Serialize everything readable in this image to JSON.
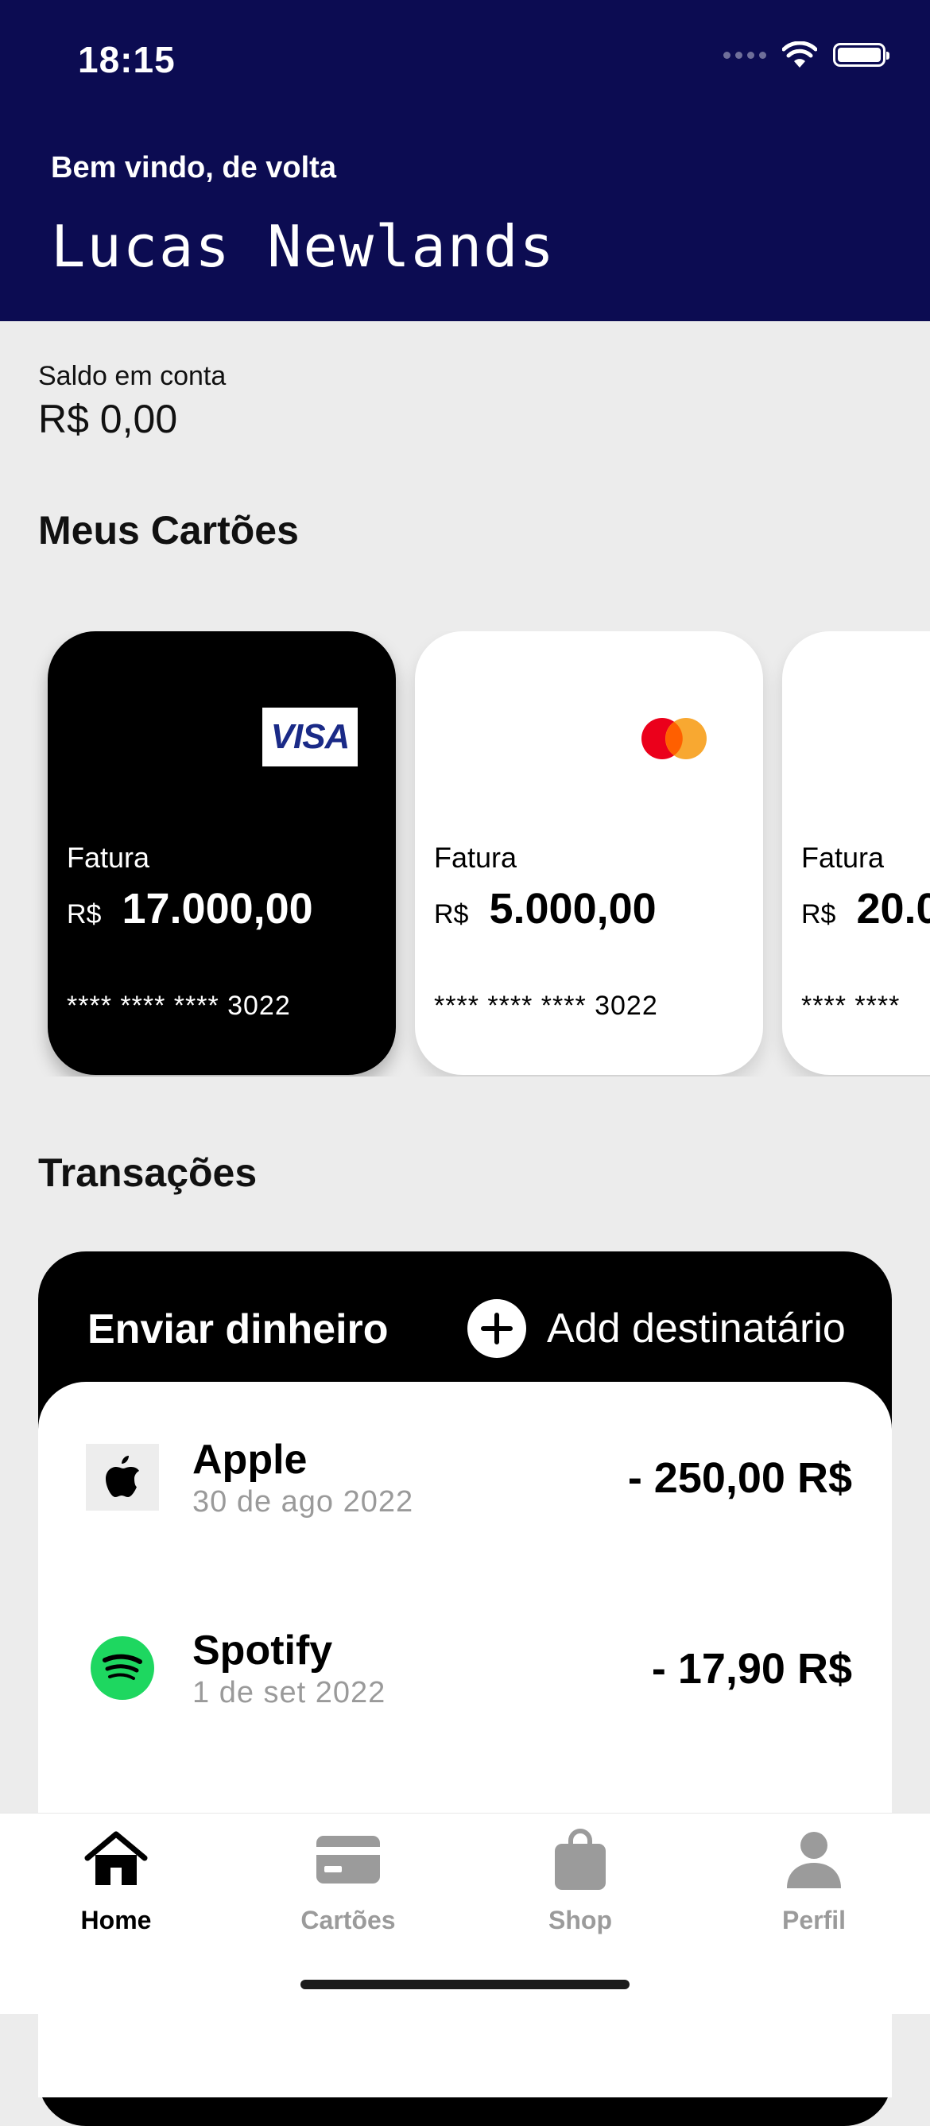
{
  "status_bar": {
    "time": "18:15",
    "wifi_icon": "wifi-icon",
    "battery_icon": "battery-icon"
  },
  "header": {
    "welcome": "Bem vindo, de volta",
    "user_name": "Lucas Newlands",
    "background": "#0c0c52"
  },
  "balance": {
    "label": "Saldo em conta",
    "value": "R$ 0,00"
  },
  "cards_section": {
    "title": "Meus Cartões",
    "cards": [
      {
        "brand": "VISA",
        "label": "Fatura",
        "currency": "R$",
        "amount": "17.000,00",
        "number": "**** **** **** 3022",
        "style": "black"
      },
      {
        "brand": "mastercard",
        "label": "Fatura",
        "currency": "R$",
        "amount": "5.000,00",
        "number": "**** **** **** 3022",
        "style": "white"
      },
      {
        "brand": "",
        "label": "Fatura",
        "currency": "R$",
        "amount": "20.0",
        "number": "**** ****",
        "style": "white"
      }
    ]
  },
  "transactions": {
    "title": "Transações",
    "send_label": "Enviar dinheiro",
    "add_label": "Add destinatário",
    "items": [
      {
        "name": "Apple",
        "date": "30 de ago  2022",
        "amount": "- 250,00 R$",
        "icon": "apple-icon"
      },
      {
        "name": "Spotify",
        "date": "1 de set 2022",
        "amount": "- 17,90 R$",
        "icon": "spotify-icon"
      }
    ]
  },
  "tabbar": {
    "tabs": [
      {
        "label": "Home",
        "icon": "home-icon",
        "active": true
      },
      {
        "label": "Cartões",
        "icon": "card-icon",
        "active": false
      },
      {
        "label": "Shop",
        "icon": "bag-icon",
        "active": false
      },
      {
        "label": "Perfil",
        "icon": "person-icon",
        "active": false
      }
    ]
  },
  "colors": {
    "accent": "#0c0c52",
    "background": "#ececec",
    "inactive": "#9b9b9b",
    "spotify": "#1ed760",
    "mc_red": "#eb001b",
    "mc_orange": "#f79e1b",
    "visa_blue": "#1a2a87"
  }
}
